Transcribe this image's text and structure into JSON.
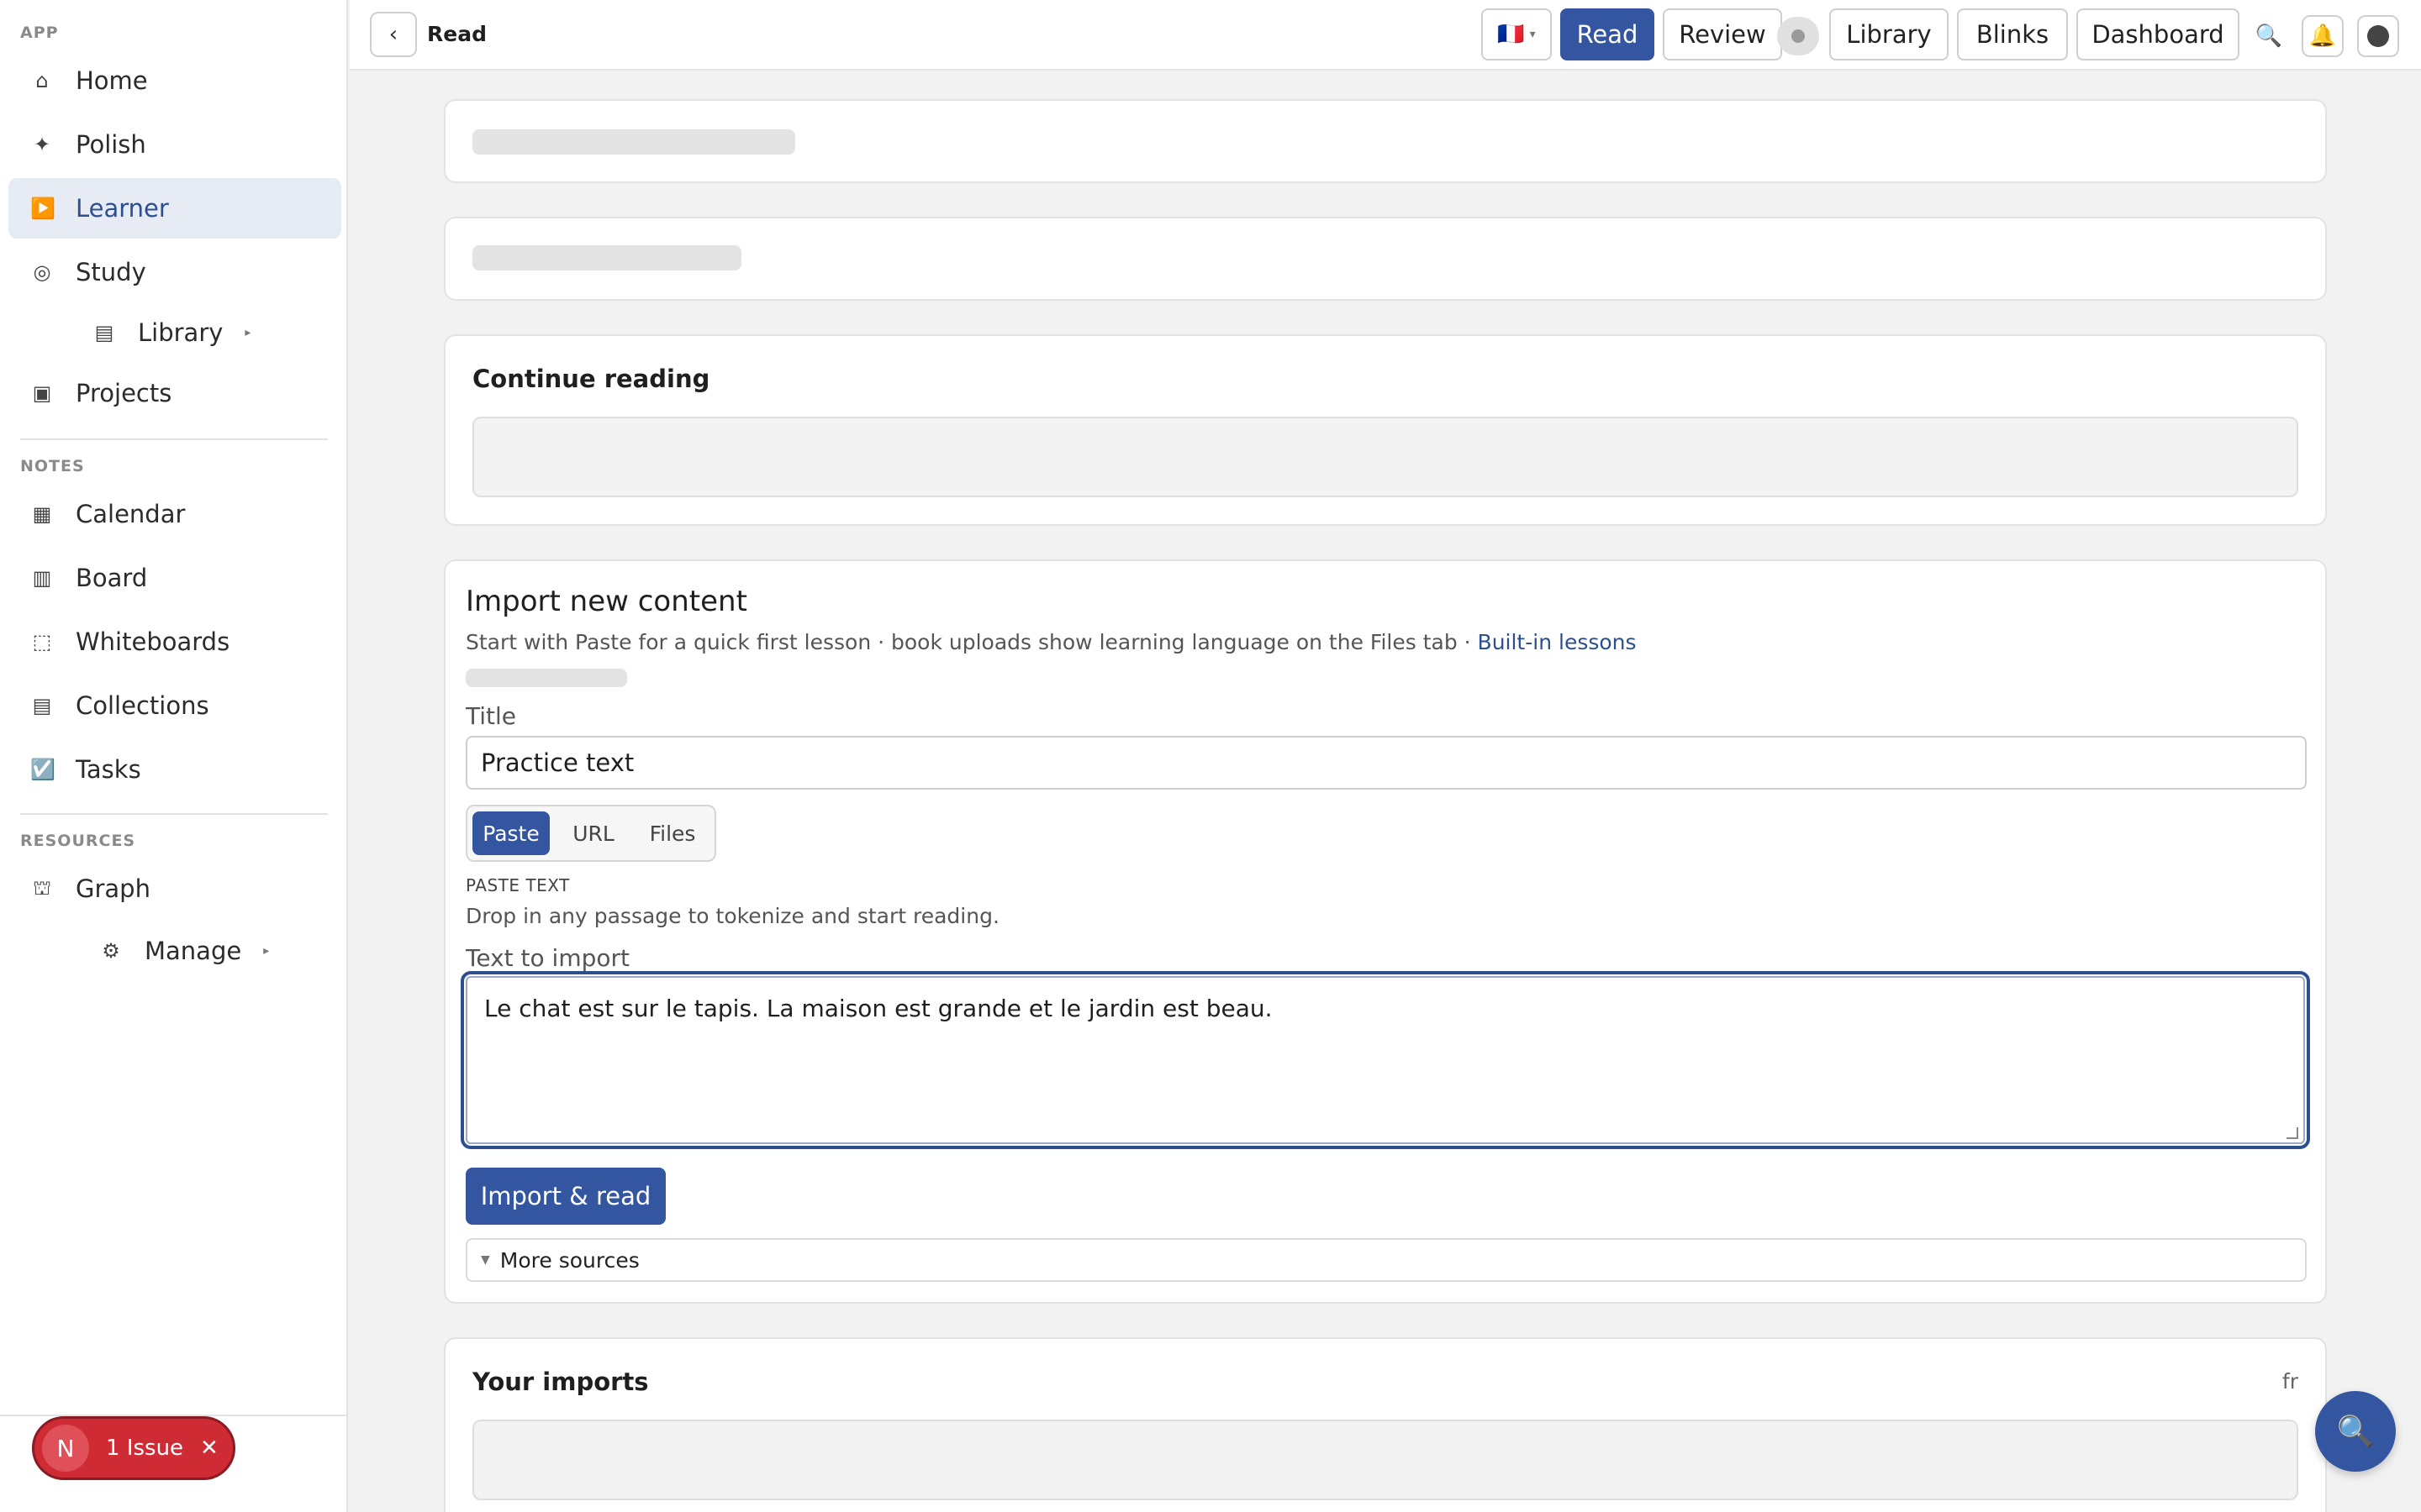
{
  "sidebar": {
    "sections": [
      "APP",
      "NOTES",
      "RESOURCES"
    ],
    "app_items": [
      {
        "label": "Home",
        "icon": "⌂"
      },
      {
        "label": "Polish",
        "icon": "✦"
      },
      {
        "label": "Learner",
        "icon": "▶️",
        "active": true
      },
      {
        "label": "Study",
        "icon": "◎"
      },
      {
        "label": "Library",
        "icon": "▤",
        "sub": true
      },
      {
        "label": "Projects",
        "icon": "▣"
      }
    ],
    "notes_items": [
      {
        "label": "Calendar",
        "icon": "▦"
      },
      {
        "label": "Board",
        "icon": "▥"
      },
      {
        "label": "Whiteboards",
        "icon": "⬚"
      },
      {
        "label": "Collections",
        "icon": "▤"
      },
      {
        "label": "Tasks",
        "icon": "☑️"
      }
    ],
    "resources_items": [
      {
        "label": "Graph",
        "icon": "⛫"
      },
      {
        "label": "Manage",
        "icon": "⚙",
        "sub": true
      }
    ],
    "issue": {
      "avatar": "N",
      "label": "1 Issue",
      "close": "✕"
    }
  },
  "topbar": {
    "back": "‹",
    "title": "Read",
    "language_flag": "🇫🇷",
    "language_caret": "▾",
    "buttons": [
      "Read",
      "Review",
      "Library",
      "Blinks",
      "Dashboard"
    ],
    "search_icon": "🔍",
    "bell_icon": "🔔"
  },
  "continue_reading": {
    "title": "Continue reading"
  },
  "import": {
    "title": "Import new content",
    "subtitle": "Start with Paste for a quick first lesson · book uploads show learning language on the Files tab · ",
    "subtitle_link": "Built-in lessons",
    "title_label": "Title",
    "title_value": "Practice text",
    "tabs": [
      "Paste",
      "URL",
      "Files"
    ],
    "active_tab": "Paste",
    "section_caption": "PASTE TEXT",
    "section_hint": "Drop in any passage to tokenize and start reading.",
    "text_label": "Text to import",
    "text_value": "Le chat est sur le tapis. La maison est grande et le jardin est beau.",
    "import_button": "Import & read",
    "more_sources": "More sources",
    "more_sources_icon": "▼"
  },
  "imports": {
    "title": "Your imports",
    "lang": "fr"
  },
  "fab_icon": "🔍"
}
